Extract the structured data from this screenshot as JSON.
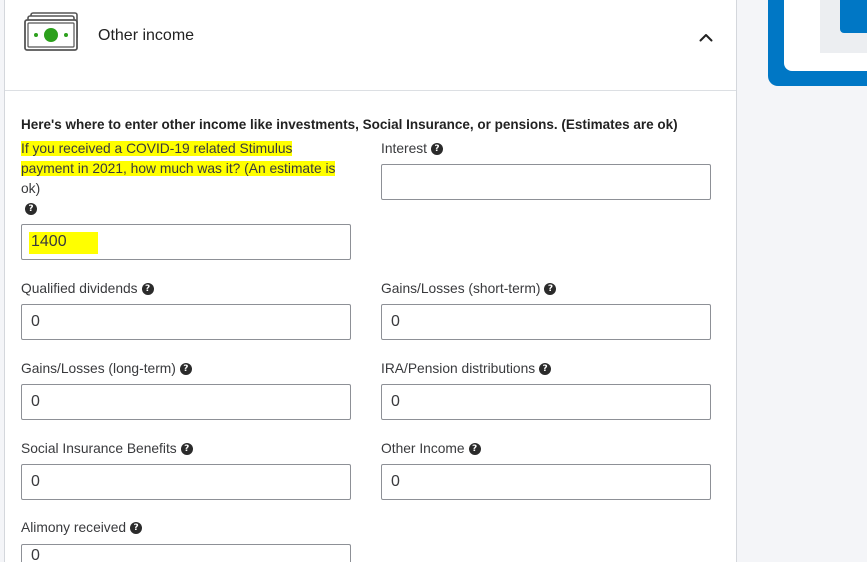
{
  "section": {
    "title": "Other income",
    "icon": "money-icon",
    "collapse_icon": "chevron-up-icon"
  },
  "intro": "Here's where to enter other income like investments, Social Insurance, or pensions. (Estimates are ok)",
  "help_glyph": "?",
  "fields": {
    "stimulus": {
      "label_line1": "If you received a COVID-19 related Stimulus",
      "label_line2": "payment in 2021, how much was it? (An estimate is",
      "label_line3": "ok)",
      "value": "1400"
    },
    "interest": {
      "label": "Interest",
      "value": ""
    },
    "qualified_dividends": {
      "label": "Qualified dividends",
      "value": "0"
    },
    "gains_short": {
      "label": "Gains/Losses (short-term)",
      "value": "0"
    },
    "gains_long": {
      "label": "Gains/Losses (long-term)",
      "value": "0"
    },
    "ira_pension": {
      "label": "IRA/Pension distributions",
      "value": "0"
    },
    "social_insurance": {
      "label": "Social Insurance Benefits",
      "value": "0"
    },
    "other_income": {
      "label": "Other Income",
      "value": "0"
    },
    "alimony": {
      "label": "Alimony received",
      "value": "0"
    }
  },
  "colors": {
    "accent": "#0077c5",
    "highlight": "#ffff00",
    "icon_green": "#2ca01c"
  }
}
